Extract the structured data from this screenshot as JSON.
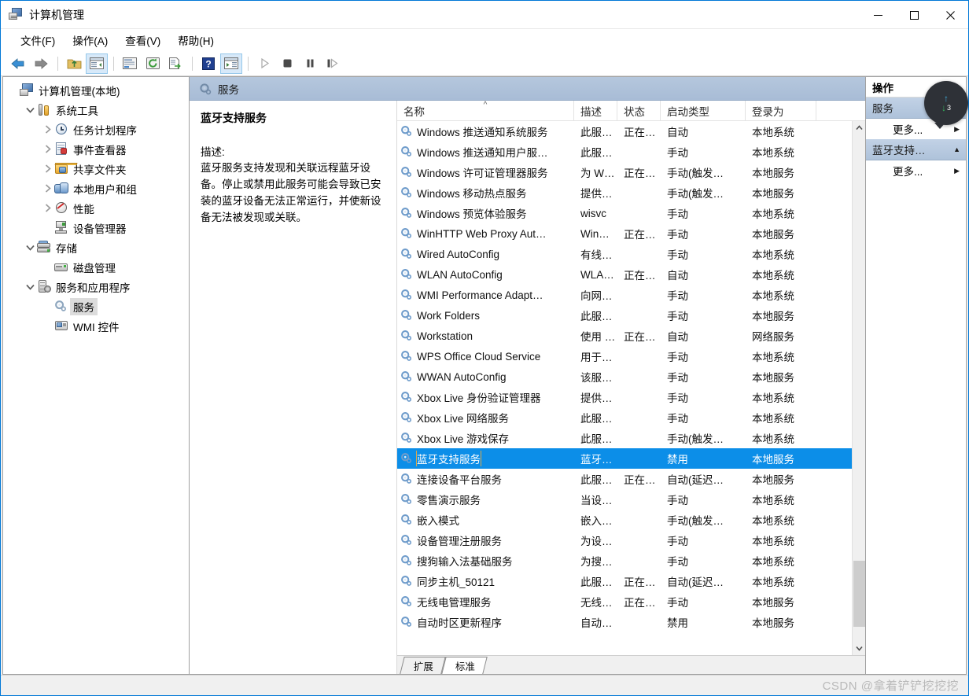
{
  "window": {
    "title": "计算机管理",
    "icon": "computer-management-icon",
    "controls": {
      "minimize": "最小化",
      "maximize": "最大化",
      "close": "关闭"
    }
  },
  "menubar": {
    "items": [
      {
        "label": "文件(F)",
        "name": "menu-file"
      },
      {
        "label": "操作(A)",
        "name": "menu-action"
      },
      {
        "label": "查看(V)",
        "name": "menu-view"
      },
      {
        "label": "帮助(H)",
        "name": "menu-help"
      }
    ]
  },
  "toolbar": {
    "buttons": [
      {
        "name": "back-icon",
        "enabled": true
      },
      {
        "name": "forward-icon",
        "enabled": true
      },
      {
        "name": "up-one-level-icon",
        "enabled": true
      },
      {
        "name": "show-hide-tree-icon",
        "enabled": true,
        "active": true
      },
      {
        "name": "properties-icon",
        "enabled": true
      },
      {
        "name": "refresh-icon",
        "enabled": true
      },
      {
        "name": "export-list-icon",
        "enabled": true
      },
      {
        "name": "help-icon",
        "enabled": true
      },
      {
        "name": "show-action-pane-icon",
        "enabled": true,
        "active": true
      },
      {
        "name": "start-service-icon",
        "enabled": false
      },
      {
        "name": "stop-service-icon",
        "enabled": false
      },
      {
        "name": "pause-service-icon",
        "enabled": false
      },
      {
        "name": "restart-service-icon",
        "enabled": false
      }
    ]
  },
  "tree": {
    "nodes": [
      {
        "label": "计算机管理(本地)",
        "indent": 0,
        "expander": "none",
        "icon": "computer-icon"
      },
      {
        "label": "系统工具",
        "indent": 1,
        "expander": "expanded",
        "icon": "tools-icon"
      },
      {
        "label": "任务计划程序",
        "indent": 2,
        "expander": "collapsed",
        "icon": "clock-icon"
      },
      {
        "label": "事件查看器",
        "indent": 2,
        "expander": "collapsed",
        "icon": "event-viewer-icon"
      },
      {
        "label": "共享文件夹",
        "indent": 2,
        "expander": "collapsed",
        "icon": "shared-folder-icon"
      },
      {
        "label": "本地用户和组",
        "indent": 2,
        "expander": "collapsed",
        "icon": "users-icon"
      },
      {
        "label": "性能",
        "indent": 2,
        "expander": "collapsed",
        "icon": "performance-icon"
      },
      {
        "label": "设备管理器",
        "indent": 2,
        "expander": "none",
        "icon": "device-manager-icon"
      },
      {
        "label": "存储",
        "indent": 1,
        "expander": "expanded",
        "icon": "storage-icon"
      },
      {
        "label": "磁盘管理",
        "indent": 2,
        "expander": "none",
        "icon": "disk-management-icon"
      },
      {
        "label": "服务和应用程序",
        "indent": 1,
        "expander": "expanded",
        "icon": "services-apps-icon"
      },
      {
        "label": "服务",
        "indent": 2,
        "expander": "none",
        "icon": "gear-icon",
        "selected": true
      },
      {
        "label": "WMI 控件",
        "indent": 2,
        "expander": "none",
        "icon": "wmi-control-icon"
      }
    ]
  },
  "main": {
    "header": {
      "title": "服务",
      "icon": "gear-icon"
    },
    "description": {
      "service_name": "蓝牙支持服务",
      "label": "描述:",
      "text": "蓝牙服务支持发现和关联远程蓝牙设备。停止或禁用此服务可能会导致已安装的蓝牙设备无法正常运行，并使新设备无法被发现或关联。"
    },
    "list": {
      "columns": [
        {
          "key": "name",
          "label": "名称",
          "sort": "asc"
        },
        {
          "key": "desc",
          "label": "描述",
          "sort": "none"
        },
        {
          "key": "state",
          "label": "状态",
          "sort": "none"
        },
        {
          "key": "start",
          "label": "启动类型",
          "sort": "none"
        },
        {
          "key": "logon",
          "label": "登录为",
          "sort": "none"
        }
      ],
      "sort_indicator": "^",
      "rows": [
        {
          "name": "Windows 推送通知系统服务",
          "desc": "此服…",
          "state": "正在…",
          "start": "自动",
          "logon": "本地系统"
        },
        {
          "name": "Windows 推送通知用户服…",
          "desc": "此服…",
          "state": "",
          "start": "手动",
          "logon": "本地系统"
        },
        {
          "name": "Windows 许可证管理器服务",
          "desc": "为 W…",
          "state": "正在…",
          "start": "手动(触发…",
          "logon": "本地服务"
        },
        {
          "name": "Windows 移动热点服务",
          "desc": "提供…",
          "state": "",
          "start": "手动(触发…",
          "logon": "本地服务"
        },
        {
          "name": "Windows 预览体验服务",
          "desc": "wisvc",
          "state": "",
          "start": "手动",
          "logon": "本地系统"
        },
        {
          "name": "WinHTTP Web Proxy Aut…",
          "desc": "Win…",
          "state": "正在…",
          "start": "手动",
          "logon": "本地服务"
        },
        {
          "name": "Wired AutoConfig",
          "desc": "有线…",
          "state": "",
          "start": "手动",
          "logon": "本地系统"
        },
        {
          "name": "WLAN AutoConfig",
          "desc": "WLA…",
          "state": "正在…",
          "start": "自动",
          "logon": "本地系统"
        },
        {
          "name": "WMI Performance Adapt…",
          "desc": "向网…",
          "state": "",
          "start": "手动",
          "logon": "本地系统"
        },
        {
          "name": "Work Folders",
          "desc": "此服…",
          "state": "",
          "start": "手动",
          "logon": "本地服务"
        },
        {
          "name": "Workstation",
          "desc": "使用 …",
          "state": "正在…",
          "start": "自动",
          "logon": "网络服务"
        },
        {
          "name": "WPS Office Cloud Service",
          "desc": "用于…",
          "state": "",
          "start": "手动",
          "logon": "本地系统"
        },
        {
          "name": "WWAN AutoConfig",
          "desc": "该服…",
          "state": "",
          "start": "手动",
          "logon": "本地服务"
        },
        {
          "name": "Xbox Live 身份验证管理器",
          "desc": "提供…",
          "state": "",
          "start": "手动",
          "logon": "本地系统"
        },
        {
          "name": "Xbox Live 网络服务",
          "desc": "此服…",
          "state": "",
          "start": "手动",
          "logon": "本地系统"
        },
        {
          "name": "Xbox Live 游戏保存",
          "desc": "此服…",
          "state": "",
          "start": "手动(触发…",
          "logon": "本地系统"
        },
        {
          "name": "蓝牙支持服务",
          "desc": "蓝牙…",
          "state": "",
          "start": "禁用",
          "logon": "本地服务",
          "selected": true
        },
        {
          "name": "连接设备平台服务",
          "desc": "此服…",
          "state": "正在…",
          "start": "自动(延迟…",
          "logon": "本地服务"
        },
        {
          "name": "零售演示服务",
          "desc": "当设…",
          "state": "",
          "start": "手动",
          "logon": "本地系统"
        },
        {
          "name": "嵌入模式",
          "desc": "嵌入…",
          "state": "",
          "start": "手动(触发…",
          "logon": "本地系统"
        },
        {
          "name": "设备管理注册服务",
          "desc": "为设…",
          "state": "",
          "start": "手动",
          "logon": "本地系统"
        },
        {
          "name": "搜狗输入法基础服务",
          "desc": "为搜…",
          "state": "",
          "start": "手动",
          "logon": "本地系统"
        },
        {
          "name": "同步主机_50121",
          "desc": "此服…",
          "state": "正在…",
          "start": "自动(延迟…",
          "logon": "本地系统"
        },
        {
          "name": "无线电管理服务",
          "desc": "无线…",
          "state": "正在…",
          "start": "手动",
          "logon": "本地服务"
        },
        {
          "name": "自动时区更新程序",
          "desc": "自动…",
          "state": "",
          "start": "禁用",
          "logon": "本地服务"
        }
      ]
    },
    "tabs": [
      {
        "label": "扩展",
        "name": "tab-extended",
        "active": false
      },
      {
        "label": "标准",
        "name": "tab-standard",
        "active": true
      }
    ],
    "scrollbar": {
      "up": "▲",
      "down": "▼",
      "thumb_position": "bottom"
    }
  },
  "actions": {
    "title": "操作",
    "groups": [
      {
        "header": "服务",
        "name": "actions-group-services",
        "expander": "▼",
        "items": [
          {
            "label": "更多...",
            "submenu": "▶",
            "name": "actions-more-services"
          }
        ]
      },
      {
        "header": "蓝牙支持…",
        "name": "actions-group-bluetooth",
        "expander": "▲",
        "highlighted": true,
        "items": [
          {
            "label": "更多...",
            "submenu": "▶",
            "name": "actions-more-bluetooth"
          }
        ]
      }
    ]
  },
  "net_widget": {
    "up_arrow": "↑",
    "down_arrow": "↓",
    "down_value": "3"
  },
  "statusbar": {
    "watermark": "CSDN @拿着铲铲挖挖挖"
  },
  "colors": {
    "window_border": "#0078d7",
    "selection_blue": "#0c8ee8",
    "header_gradient_top": "#b5c7dd",
    "action_header": "#c2d2e6",
    "watermark_gray": "#b9b9b9"
  }
}
